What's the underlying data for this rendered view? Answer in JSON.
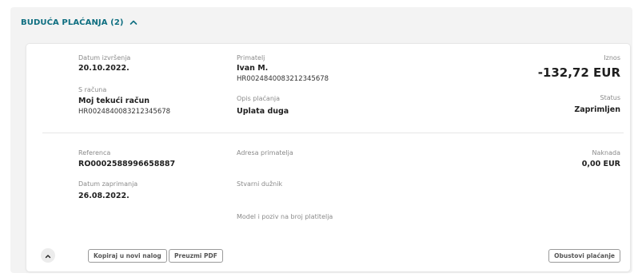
{
  "section": {
    "title": "BUDUĆA PLAĆANJA (2)",
    "toggle_icon": "chevron-up-icon"
  },
  "payment": {
    "execution_date_label": "Datum izvršenja",
    "execution_date": "20.10.2022.",
    "from_account_label": "S računa",
    "from_account_name": "Moj tekući račun",
    "from_account_iban": "HR0024840083212345678",
    "recipient_label": "Primatelj",
    "recipient_name": "Ivan M.",
    "recipient_iban": "HR0024840083212345678",
    "description_label": "Opis plaćanja",
    "description": "Uplata duga",
    "amount_label": "Iznos",
    "amount": "-132,72 EUR",
    "status_label": "Status",
    "status": "Zaprimljen",
    "reference_label": "Referenca",
    "reference": "RO0002588996658887",
    "received_date_label": "Datum zaprimanja",
    "received_date": "26.08.2022.",
    "recipient_address_label": "Adresa primatelja",
    "actual_debtor_label": "Stvarni dužnik",
    "model_label": "Model i poziv na broj platitelja",
    "fee_label": "Naknada",
    "fee": "0,00 EUR"
  },
  "actions": {
    "collapse_icon": "chevron-up-icon",
    "copy_label": "Kopiraj u novi nalog",
    "pdf_label": "Preuzmi PDF",
    "cancel_label": "Obustovi plaćanje"
  },
  "colors": {
    "accent": "#0e6e80",
    "panel_bg": "#f3f3f3"
  }
}
